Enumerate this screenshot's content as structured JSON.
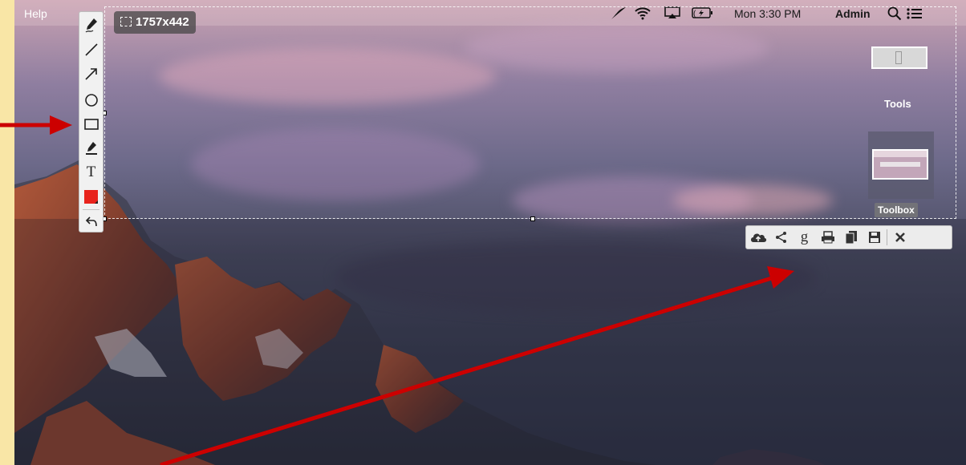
{
  "menubar": {
    "help_label": "Help",
    "clock": "Mon 3:30 PM",
    "user": "Admin"
  },
  "selection": {
    "size_label": "1757x442"
  },
  "left_toolbar": {
    "tools": [
      "pen-icon",
      "line-icon",
      "arrow-icon",
      "ellipse-icon",
      "rectangle-icon",
      "marker-icon",
      "text-icon",
      "color-swatch",
      "undo-icon"
    ],
    "color": "#e8231c"
  },
  "right_panel": {
    "tools_label": "Tools",
    "toolbox_label": "Toolbox"
  },
  "action_toolbar": {
    "buttons": [
      "upload-cloud-icon",
      "share-icon",
      "google-search-icon",
      "print-icon",
      "copy-icon",
      "save-icon",
      "close-icon"
    ]
  },
  "annotations": {
    "arrow_color": "#cc0000",
    "background_color": "#f9e6a6"
  }
}
